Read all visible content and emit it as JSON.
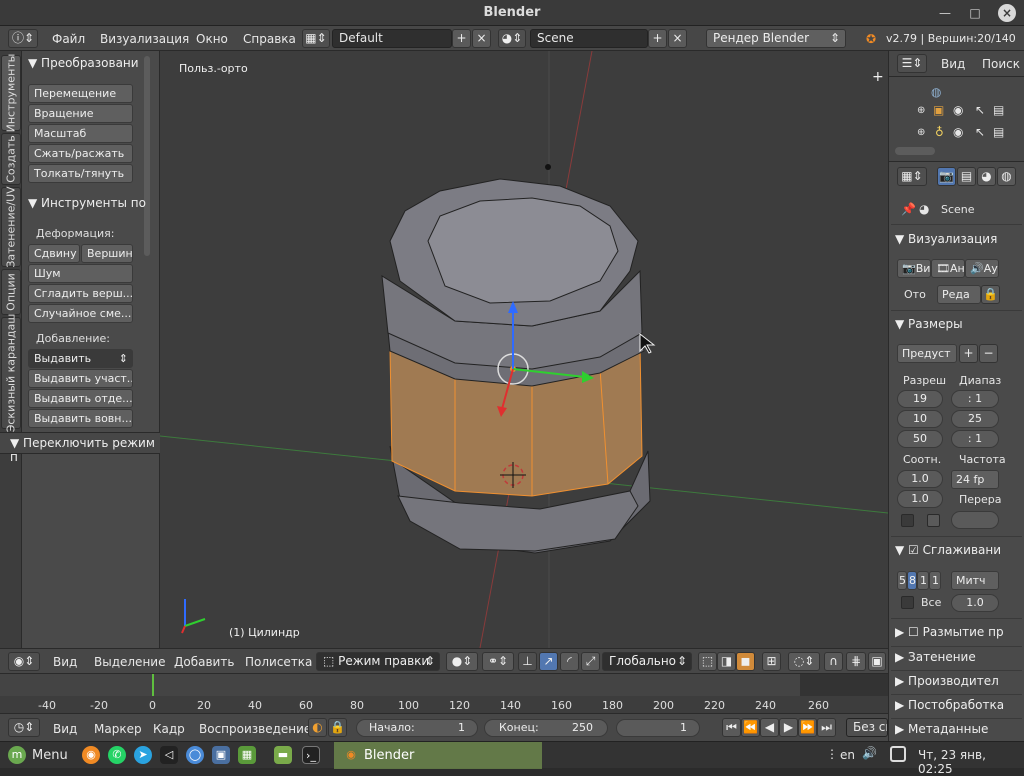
{
  "window": {
    "title": "Blender"
  },
  "info_header": {
    "menus": [
      "Файл",
      "Визуализация",
      "Окно",
      "Справка"
    ],
    "screen_layout": "Default",
    "scene": "Scene",
    "render_engine": "Рендер Blender",
    "stats": "v2.79 | Вершин:20/140"
  },
  "left_tabs": [
    "Инструменты",
    "Создать",
    "Затенение/UV",
    "Опции",
    "Эскизный карандаш"
  ],
  "tool_shelf": {
    "transform_header": "Преобразовани",
    "transform_buttons": [
      "Перемещение",
      "Вращение",
      "Масштаб",
      "Сжать/расжать",
      "Толкать/тянуть"
    ],
    "tools_header": "Инструменты по",
    "deform_label": "Деформация:",
    "deform_row": [
      "Сдвину",
      "Вершин"
    ],
    "deform_buttons": [
      "Шум",
      "Сгладить верш...",
      "Случайное сме..."
    ],
    "add_label": "Добавление:",
    "extrude_select": "Выдавить",
    "add_buttons": [
      "Выдавить участ...",
      "Выдавить отде...",
      "Выдавить вовн..."
    ],
    "toggle_header": "Переключить режим п"
  },
  "viewport": {
    "view_label": "Польз.-орто",
    "object_label": "(1) Цилиндр"
  },
  "viewport_header": {
    "menus": [
      "Вид",
      "Выделение",
      "Добавить",
      "Полисетка"
    ],
    "mode": "Режим правки",
    "orientation": "Глобально"
  },
  "timeline": {
    "ticks": [
      "-40",
      "-20",
      "0",
      "20",
      "40",
      "60",
      "80",
      "100",
      "120",
      "140",
      "160",
      "180",
      "200",
      "220",
      "240",
      "260"
    ],
    "current_frame_marker": 0
  },
  "timeline_header": {
    "menus": [
      "Вид",
      "Маркер",
      "Кадр",
      "Воспроизведение"
    ],
    "start_label": "Начало:",
    "start_value": "1",
    "end_label": "Конец:",
    "end_value": "250",
    "current_frame": "1",
    "sync": "Без си"
  },
  "outliner": {
    "menus": [
      "Вид",
      "Поиск"
    ]
  },
  "properties": {
    "scene_label": "Scene",
    "render_header": "Визуализация",
    "render_buttons": [
      "Ви",
      "Ан",
      "Ау"
    ],
    "display_label": "Ото",
    "display_value": "Реда",
    "dimensions_header": "Размеры",
    "preset": "Предуст",
    "resolution_label": "Разреш",
    "range_label": "Диапаз",
    "res_x": "19",
    "res_y": "10",
    "res_pct": "50",
    "range_1": ": 1",
    "range_2": "25",
    "range_3": ": 1",
    "aspect_label": "Соотн.",
    "fps_label": "Частота",
    "aspect_x": "1.0",
    "aspect_y": "1.0",
    "fps_value": "24 fp",
    "remap_label": "Перера",
    "aa_header": "Сглаживани",
    "aa_samples": [
      "5",
      "8",
      "1",
      "1"
    ],
    "aa_filter": "Митч",
    "aa_full_label": "Все",
    "aa_size": "1.0",
    "motion_blur_header": "Размытие пр",
    "shading_header": "Затенение",
    "performance_header": "Производител",
    "postprocess_header": "Постобработка",
    "metadata_header": "Метаданные"
  },
  "taskbar": {
    "menu_label": "Menu",
    "active_app": "Blender",
    "lang": "en",
    "clock": "Чт, 23 янв, 02:25"
  }
}
